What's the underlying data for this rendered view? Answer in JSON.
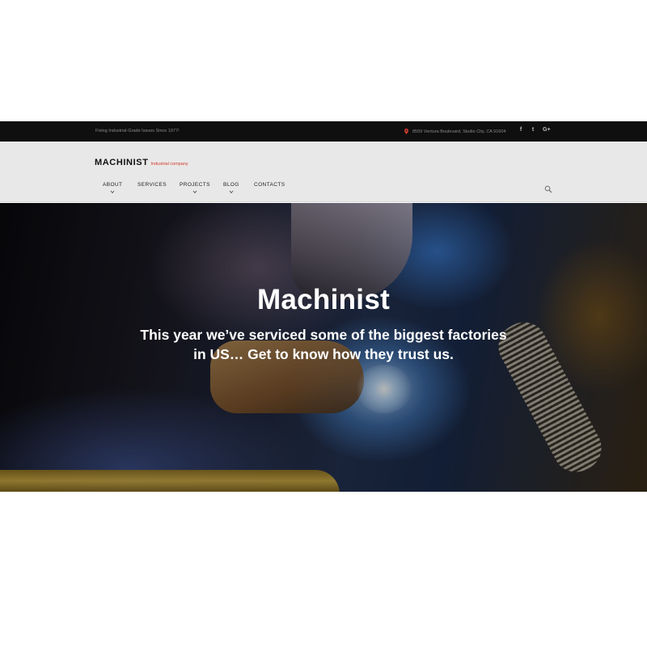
{
  "topbar": {
    "tagline": "Fixing Industrial-Grade Issues Since 1977!",
    "address": "8559 Ventura Boulevard, Studio City, CA 91604",
    "social": [
      {
        "icon": "facebook-icon",
        "glyph": "f"
      },
      {
        "icon": "twitter-icon",
        "glyph": "t"
      },
      {
        "icon": "google-plus-icon",
        "glyph": "G+"
      }
    ]
  },
  "header": {
    "brand": "MACHINIST",
    "brand_sub": "Industrial company"
  },
  "nav": {
    "items": [
      {
        "label": "ABOUT",
        "has_dropdown": true
      },
      {
        "label": "SERVICES",
        "has_dropdown": false
      },
      {
        "label": "PROJECTS",
        "has_dropdown": true
      },
      {
        "label": "BLOG",
        "has_dropdown": true
      },
      {
        "label": "CONTACTS",
        "has_dropdown": false
      }
    ],
    "search_icon": "search-icon"
  },
  "hero": {
    "title": "Machinist",
    "subtitle": "This year we’ve serviced some of the biggest factories in US… Get to know how they trust us."
  },
  "colors": {
    "topbar_bg": "#0f0f0f",
    "header_bg": "#e9e8e8",
    "accent": "#d13b2f"
  }
}
